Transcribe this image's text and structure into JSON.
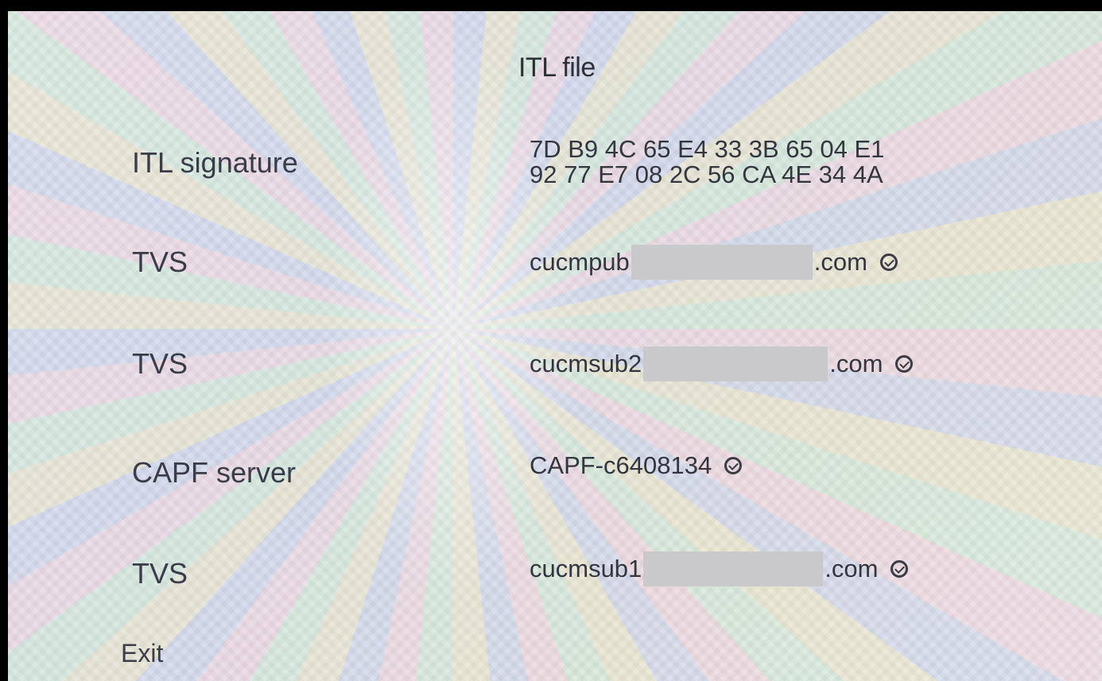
{
  "screen": {
    "title": "ITL file"
  },
  "rows": [
    {
      "label": "ITL signature",
      "value_lines": [
        "7D B9 4C 65 E4 33 3B 65 04 E1",
        "92 77 E7 08 2C 56 CA 4E 34 4A"
      ]
    },
    {
      "label": "TVS",
      "value_prefix": "cucmpub",
      "value_suffix": ".com",
      "status_icon": "check-circle-icon"
    },
    {
      "label": "TVS",
      "value_prefix": "cucmsub2",
      "value_suffix": ".com",
      "status_icon": "check-circle-icon"
    },
    {
      "label": "CAPF server",
      "value": "CAPF-c6408134",
      "status_icon": "check-circle-icon"
    },
    {
      "label": "TVS",
      "value_prefix": "cucmsub1",
      "value_suffix": ".com",
      "status_icon": "check-circle-icon"
    }
  ],
  "softkeys": {
    "exit_label": "Exit"
  }
}
